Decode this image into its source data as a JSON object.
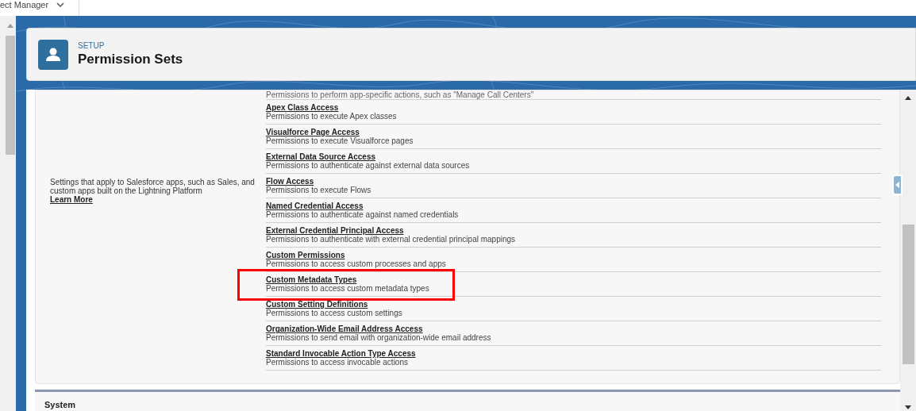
{
  "app_menu": {
    "label": "ect Manager"
  },
  "header": {
    "eyebrow": "SETUP",
    "title": "Permission Sets"
  },
  "section": {
    "description": "Settings that apply to Salesforce apps, such as Sales, and custom apps built on the Lightning Platform",
    "link": "Learn More",
    "items": [
      {
        "description": "Permissions to perform app-specific actions, such as \"Manage Call Centers\"",
        "highlighted": false
      },
      {
        "title": "Apex Class Access",
        "description": "Permissions to execute Apex classes",
        "highlighted": false
      },
      {
        "title": "Visualforce Page Access",
        "description": "Permissions to execute Visualforce pages",
        "highlighted": false
      },
      {
        "title": "External Data Source Access",
        "description": "Permissions to authenticate against external data sources",
        "highlighted": false
      },
      {
        "title": "Flow Access",
        "description": "Permissions to execute Flows",
        "highlighted": false
      },
      {
        "title": "Named Credential Access",
        "description": "Permissions to authenticate against named credentials",
        "highlighted": false
      },
      {
        "title": "External Credential Principal Access",
        "description": "Permissions to authenticate with external credential principal mappings",
        "highlighted": false
      },
      {
        "title": "Custom Permissions",
        "description": "Permissions to access custom processes and apps",
        "highlighted": false
      },
      {
        "title": "Custom Metadata Types",
        "description": "Permissions to access custom metadata types",
        "highlighted": true
      },
      {
        "title": "Custom Setting Definitions",
        "description": "Permissions to access custom settings",
        "highlighted": false
      },
      {
        "title": "Organization-Wide Email Address Access",
        "description": "Permissions to send email with organization-wide email address",
        "highlighted": false
      },
      {
        "title": "Standard Invocable Action Type Access",
        "description": "Permissions to access invocable actions",
        "highlighted": false
      }
    ]
  },
  "next_section": {
    "title": "System"
  }
}
